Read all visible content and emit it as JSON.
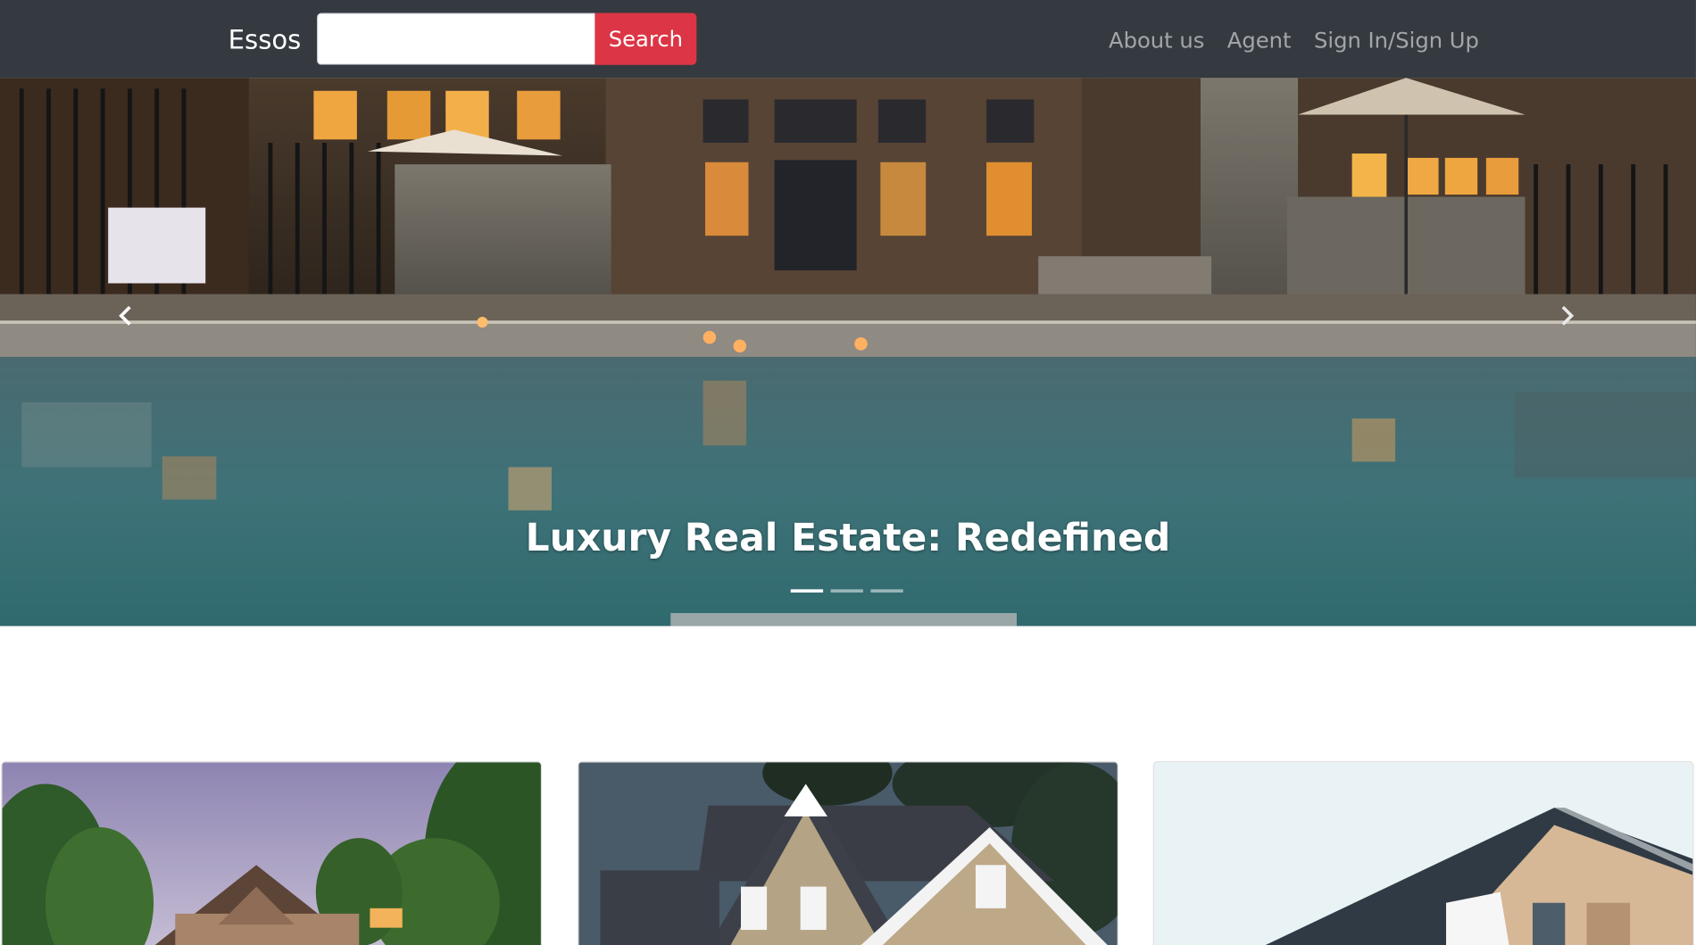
{
  "navbar": {
    "brand": "Essos",
    "search": {
      "value": "",
      "placeholder": "",
      "button_label": "Search"
    },
    "links": [
      "About us",
      "Agent",
      "Sign In/Sign Up"
    ],
    "colors": {
      "background": "#343a40",
      "accent": "#dc3545"
    }
  },
  "hero": {
    "caption": "Luxury Real Estate: Redefined",
    "slide_count": 3,
    "active_slide": 1,
    "controls": {
      "prev_icon": "chevron-left-icon",
      "next_icon": "chevron-right-icon"
    }
  },
  "listings": [
    {
      "image": "brick-house-photo"
    },
    {
      "image": "suburban-house-photo"
    },
    {
      "image": "modern-house-photo"
    }
  ]
}
